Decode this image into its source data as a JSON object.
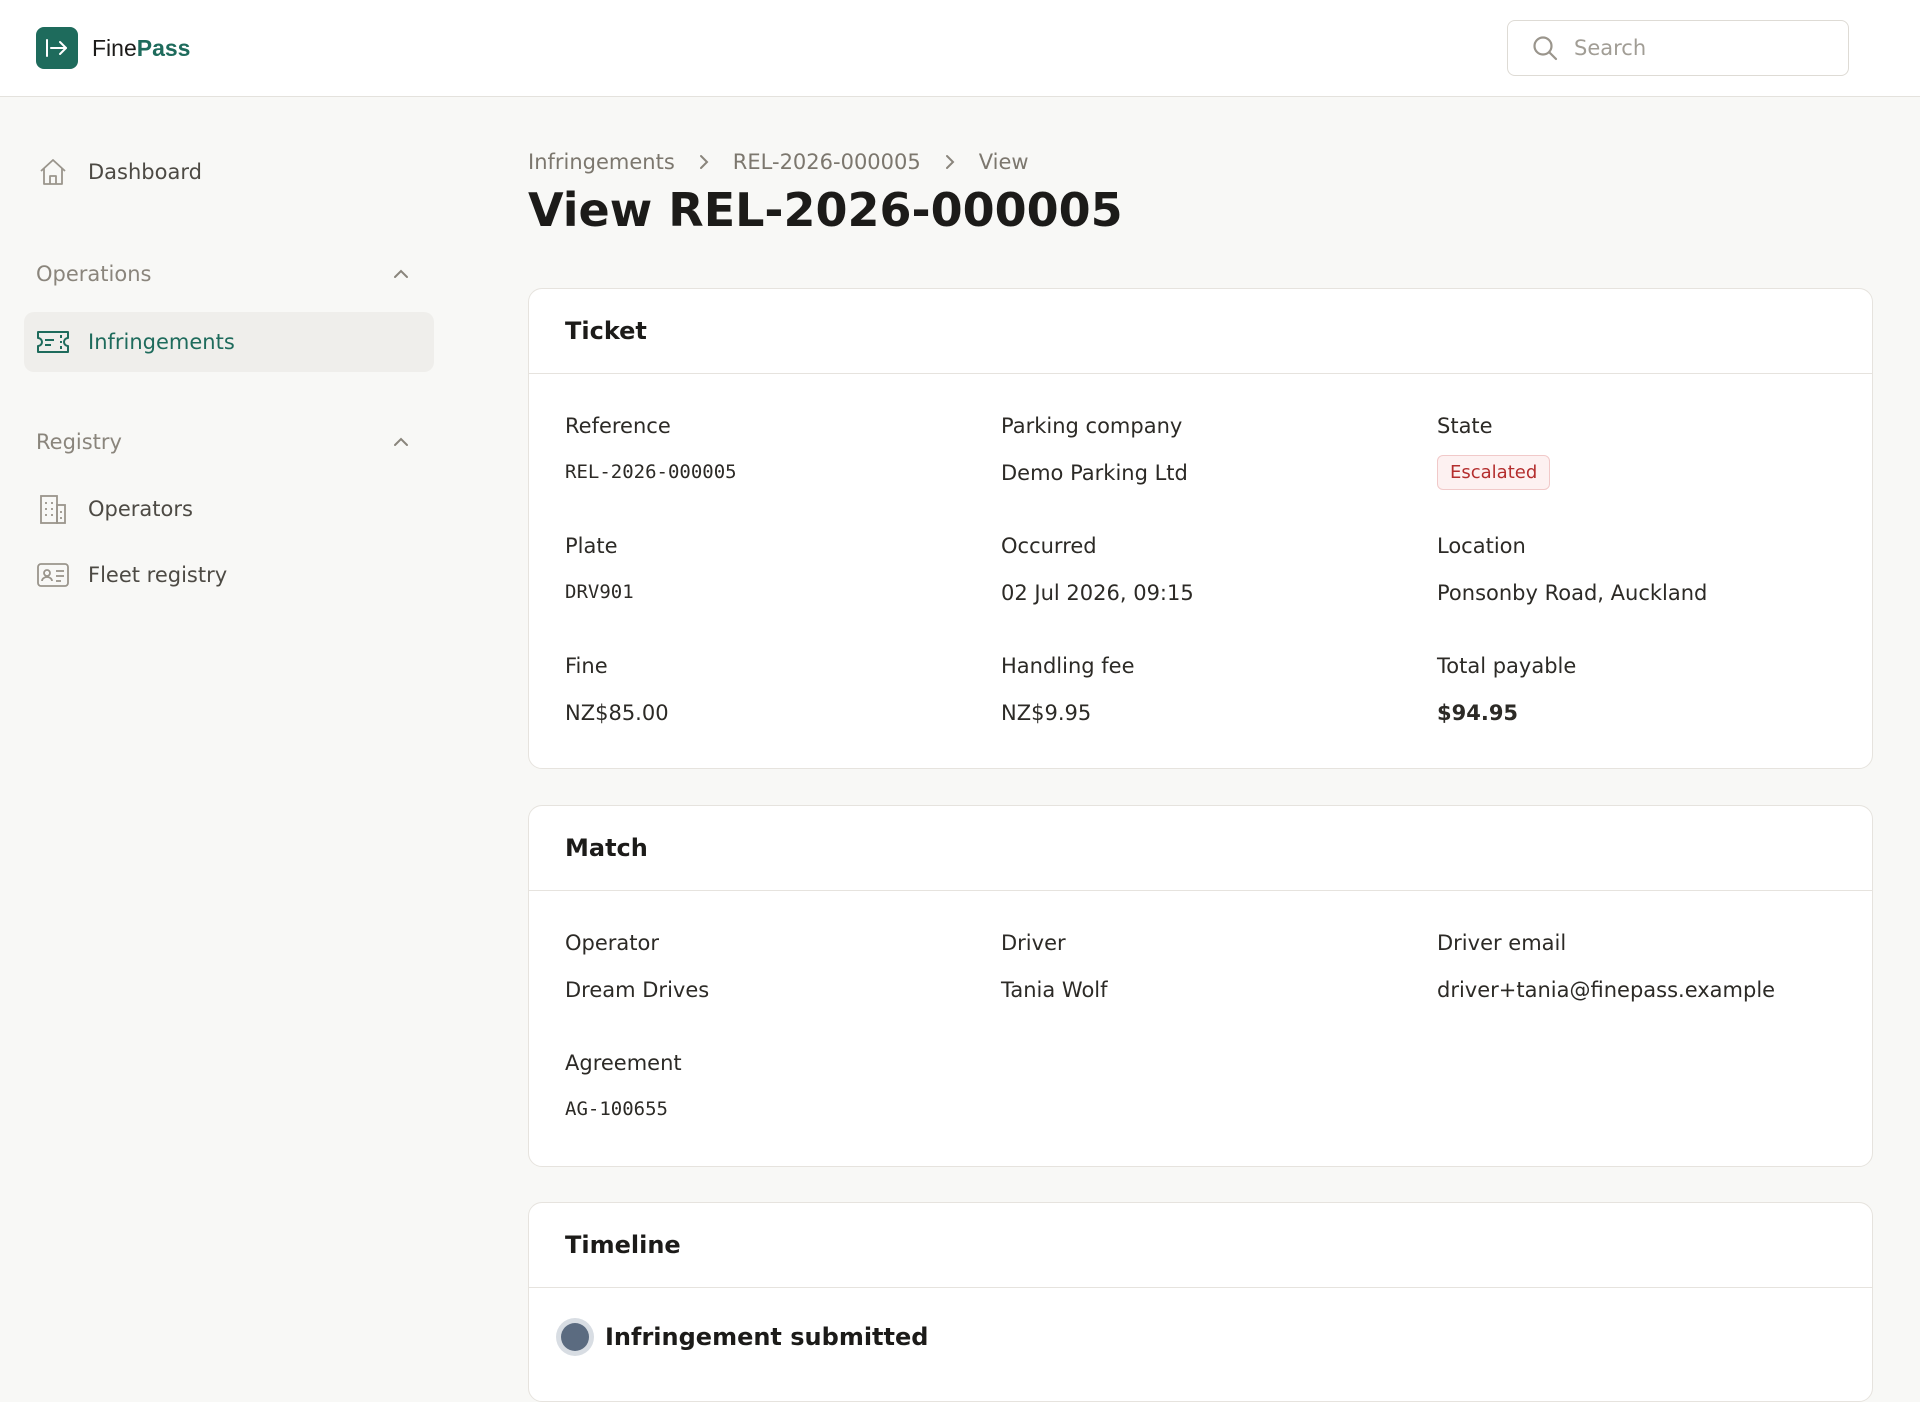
{
  "brand": {
    "name_prefix": "Fine",
    "name_accent": "Pass",
    "accent_color": "#1e6b5c"
  },
  "search": {
    "placeholder": "Search"
  },
  "sidebar": {
    "dashboard": "Dashboard",
    "groups": [
      {
        "label": "Operations",
        "items": [
          {
            "label": "Infringements",
            "icon": "ticket-icon",
            "active": true
          }
        ]
      },
      {
        "label": "Registry",
        "items": [
          {
            "label": "Operators",
            "icon": "building-icon"
          },
          {
            "label": "Fleet registry",
            "icon": "id-card-icon"
          }
        ]
      }
    ]
  },
  "breadcrumb": [
    "Infringements",
    "REL-2026-000005",
    "View"
  ],
  "page_title": "View REL-2026-000005",
  "ticket": {
    "title": "Ticket",
    "reference_label": "Reference",
    "reference": "REL-2026-000005",
    "company_label": "Parking company",
    "company": "Demo Parking Ltd",
    "state_label": "State",
    "state": "Escalated",
    "plate_label": "Plate",
    "plate": "DRV901",
    "occurred_label": "Occurred",
    "occurred": "02 Jul 2026, 09:15",
    "location_label": "Location",
    "location": "Ponsonby Road, Auckland",
    "fine_label": "Fine",
    "fine": "NZ$85.00",
    "fee_label": "Handling fee",
    "fee": "NZ$9.95",
    "total_label": "Total payable",
    "total": "$94.95"
  },
  "match": {
    "title": "Match",
    "operator_label": "Operator",
    "operator": "Dream Drives",
    "driver_label": "Driver",
    "driver": "Tania Wolf",
    "email_label": "Driver email",
    "email": "driver+tania@finepass.example",
    "agreement_label": "Agreement",
    "agreement": "AG-100655"
  },
  "timeline": {
    "title": "Timeline",
    "events": [
      "Infringement submitted"
    ]
  }
}
